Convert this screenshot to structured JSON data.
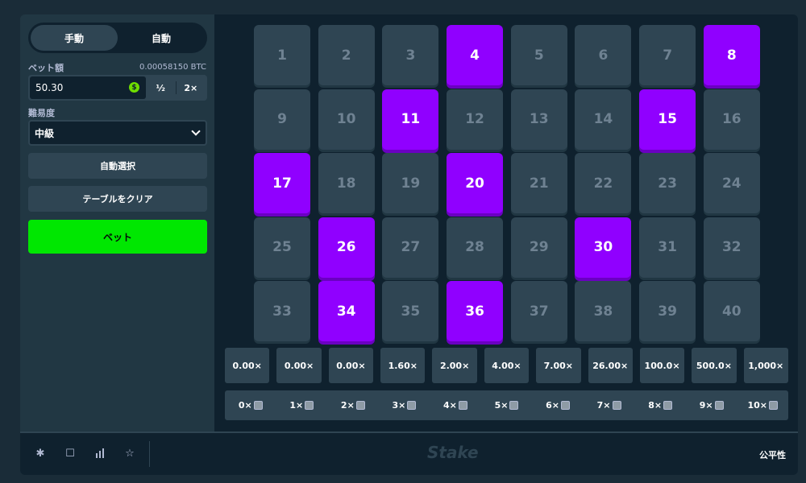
{
  "sidebar": {
    "mode_tabs": [
      {
        "label": "手動",
        "active": true
      },
      {
        "label": "自動",
        "active": false
      }
    ],
    "bet_amount_label": "ベット額",
    "bet_amount_crypto": "0.00058150 BTC",
    "bet_amount_value": "50.30",
    "coin_icon": "dollar-coin-icon",
    "coin_symbol": "$",
    "half_label": "½",
    "double_label": "2×",
    "difficulty_label": "難易度",
    "difficulty_value": "中級",
    "auto_pick_label": "自動選択",
    "clear_table_label": "テーブルをクリア",
    "bet_label": "ベット"
  },
  "board": {
    "tiles": [
      1,
      2,
      3,
      4,
      5,
      6,
      7,
      8,
      9,
      10,
      11,
      12,
      13,
      14,
      15,
      16,
      17,
      18,
      19,
      20,
      21,
      22,
      23,
      24,
      25,
      26,
      27,
      28,
      29,
      30,
      31,
      32,
      33,
      34,
      35,
      36,
      37,
      38,
      39,
      40
    ],
    "selected": [
      4,
      8,
      11,
      15,
      17,
      20,
      26,
      30,
      34,
      36
    ],
    "payouts": [
      "0.00×",
      "0.00×",
      "0.00×",
      "1.60×",
      "2.00×",
      "4.00×",
      "7.00×",
      "26.00×",
      "100.0×",
      "500.0×",
      "1,000×"
    ],
    "hits": [
      "0×",
      "1×",
      "2×",
      "3×",
      "4×",
      "5×",
      "6×",
      "7×",
      "8×",
      "9×",
      "10×"
    ]
  },
  "footer": {
    "icons": [
      "gear-icon",
      "square-icon",
      "chart-icon",
      "star-icon"
    ],
    "logo": "Stake",
    "fairness_label": "公平性"
  },
  "colors": {
    "selected_tile": "#9000ff",
    "tile": "#2f4553",
    "bet_button": "#00e701"
  }
}
